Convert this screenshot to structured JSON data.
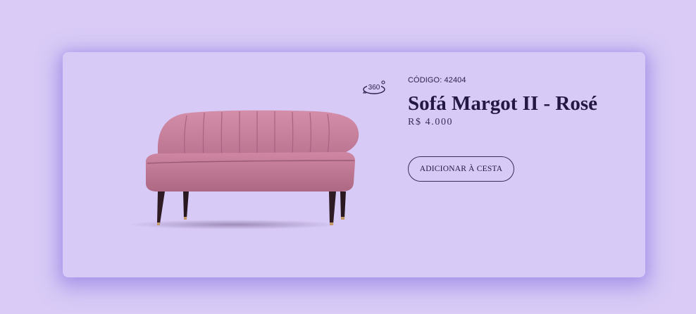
{
  "product": {
    "code_label": "CÓDIGO: 42404",
    "name": "Sofá Margot II - Rosé",
    "price": "R$ 4.000",
    "add_to_cart_label": "ADICIONAR À CESTA",
    "view_360_label": "360°",
    "image_icon": "sofa-product-image",
    "view_icon": "view-360-icon"
  },
  "colors": {
    "background": "#d9cbf6",
    "card": "#d8caf6",
    "text": "#231843",
    "sofa": "#c97f9c",
    "legs": "#2e1b24"
  }
}
